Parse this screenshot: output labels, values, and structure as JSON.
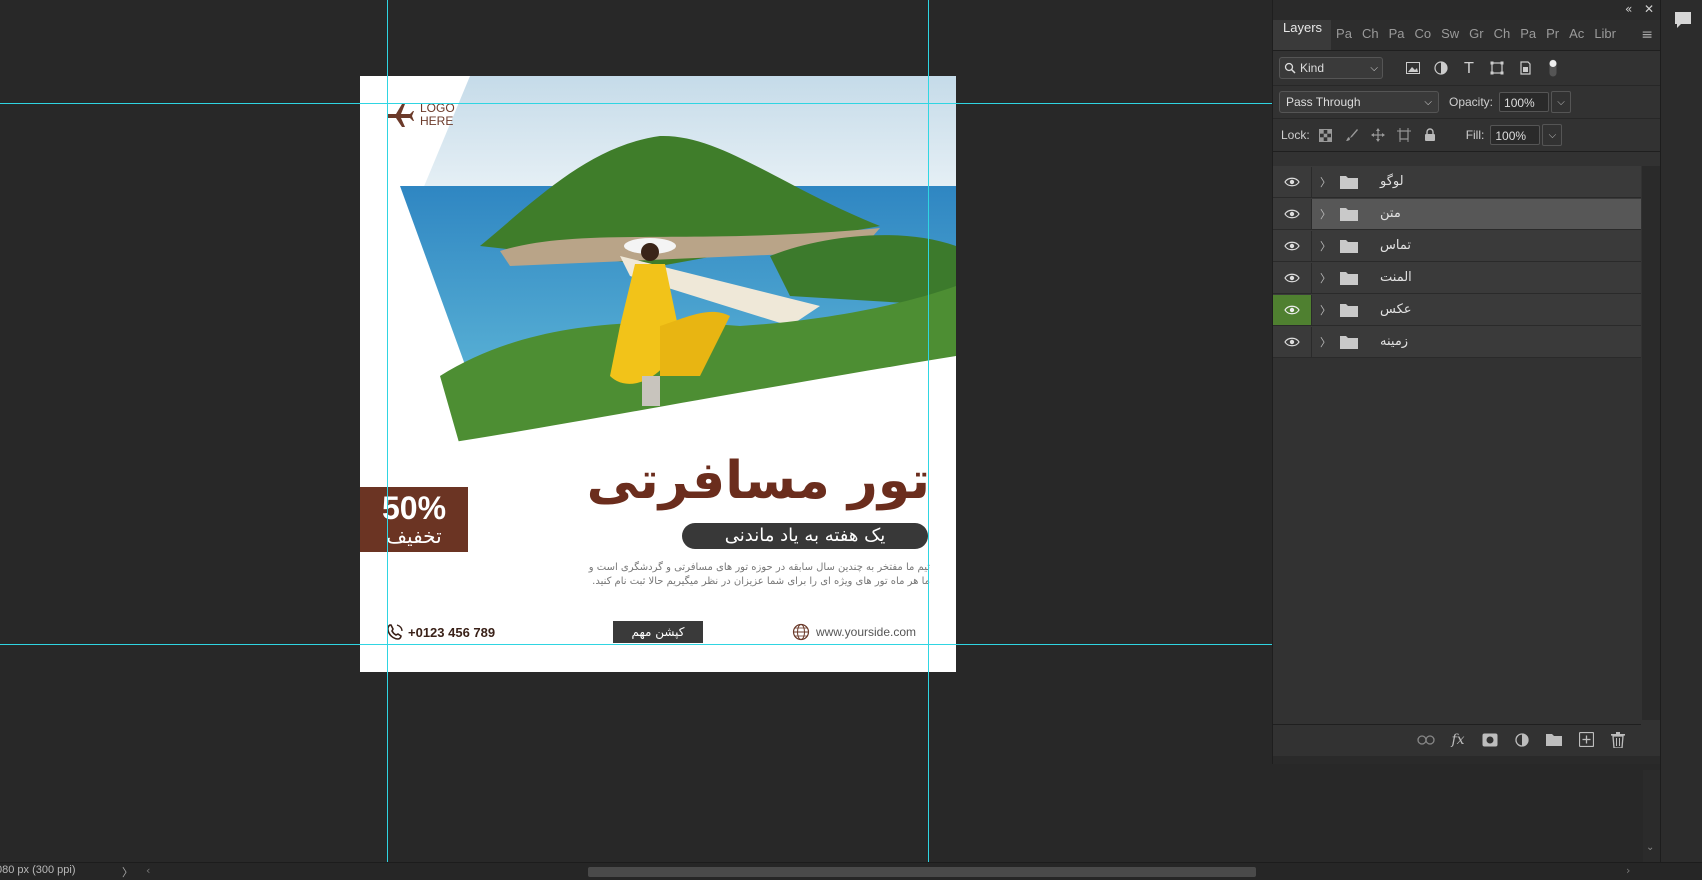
{
  "canvas": {
    "logo_line1": "LOGO",
    "logo_line2": "HERE",
    "title": "تور مسافرتی",
    "subtitle": "یک هفته به یاد ماندنی",
    "badge_percent": "50%",
    "badge_text": "تخفیف",
    "description_line1": "تیم ما مفتخر به چندین سال سابقه در حوزه تور های مسافرتی و گردشگری است و",
    "description_line2": "ما هر ماه تور های ویژه ای را برای شما عزیزان در نظر میگیریم حالا ثبت نام کنید.",
    "phone": "+0123 456 789",
    "cta_button": "کپشن مهم",
    "website": "www.yourside.com"
  },
  "layers_panel": {
    "tabs": [
      "Layers",
      "Pa",
      "Ch",
      "Pa",
      "Co",
      "Sw",
      "Gr",
      "Ch",
      "Pa",
      "Pr",
      "Ac",
      "Libr"
    ],
    "filter_kind": "Kind",
    "blend_mode": "Pass Through",
    "opacity_label": "Opacity:",
    "opacity_value": "100%",
    "lock_label": "Lock:",
    "fill_label": "Fill:",
    "fill_value": "100%",
    "layers": [
      {
        "name": "لوگو",
        "selected": false,
        "eye_highlight": false
      },
      {
        "name": "متن",
        "selected": true,
        "eye_highlight": false
      },
      {
        "name": "تماس",
        "selected": false,
        "eye_highlight": false
      },
      {
        "name": "المنت",
        "selected": false,
        "eye_highlight": false
      },
      {
        "name": "عکس",
        "selected": false,
        "eye_highlight": true
      },
      {
        "name": "زمینه",
        "selected": false,
        "eye_highlight": false
      }
    ]
  },
  "status_bar": {
    "doc_info": "080 px (300 ppi)"
  },
  "colors": {
    "guide": "#2fd5e2",
    "brand_brown": "#6b3423",
    "eye_green": "#4f8030"
  }
}
